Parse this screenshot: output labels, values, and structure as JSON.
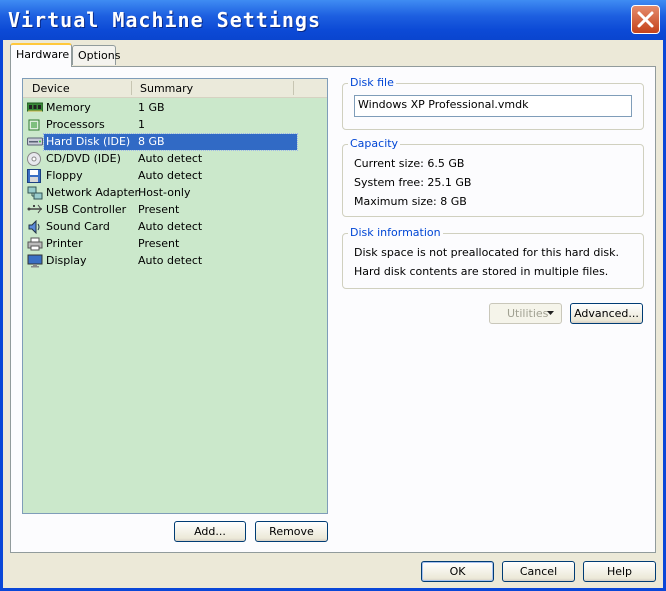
{
  "window": {
    "title": "Virtual Machine Settings"
  },
  "tabs": [
    {
      "label": "Hardware"
    },
    {
      "label": "Options"
    }
  ],
  "device_list": {
    "columns": [
      "Device",
      "Summary"
    ],
    "rows": [
      {
        "name": "Memory",
        "summary": "1 GB",
        "icon": "memory-icon"
      },
      {
        "name": "Processors",
        "summary": "1",
        "icon": "processor-icon"
      },
      {
        "name": "Hard Disk (IDE)",
        "summary": "8 GB",
        "icon": "hard-disk-icon",
        "selected": true
      },
      {
        "name": "CD/DVD (IDE)",
        "summary": "Auto detect",
        "icon": "cd-dvd-icon"
      },
      {
        "name": "Floppy",
        "summary": "Auto detect",
        "icon": "floppy-icon"
      },
      {
        "name": "Network Adapter",
        "summary": "Host-only",
        "icon": "network-adapter-icon"
      },
      {
        "name": "USB Controller",
        "summary": "Present",
        "icon": "usb-icon"
      },
      {
        "name": "Sound Card",
        "summary": "Auto detect",
        "icon": "sound-card-icon"
      },
      {
        "name": "Printer",
        "summary": "Present",
        "icon": "printer-icon"
      },
      {
        "name": "Display",
        "summary": "Auto detect",
        "icon": "display-icon"
      }
    ]
  },
  "buttons": {
    "add": "Add...",
    "remove": "Remove",
    "utilities": "Utilities",
    "advanced": "Advanced...",
    "ok": "OK",
    "cancel": "Cancel",
    "help": "Help"
  },
  "disk_file": {
    "label": "Disk file",
    "value": "Windows XP Professional.vmdk"
  },
  "capacity": {
    "label": "Capacity",
    "current": "Current size: 6.5 GB",
    "free": "System free: 25.1 GB",
    "maximum": "Maximum size: 8 GB"
  },
  "disk_information": {
    "label": "Disk information",
    "line1": "Disk space is not preallocated for this hard disk.",
    "line2": "Hard disk contents are stored in multiple files."
  },
  "colors": {
    "titlebar": "#0c4ad6",
    "list_bg": "#cbe8cb",
    "selection": "#316ac5",
    "group_label": "#0046d5"
  }
}
